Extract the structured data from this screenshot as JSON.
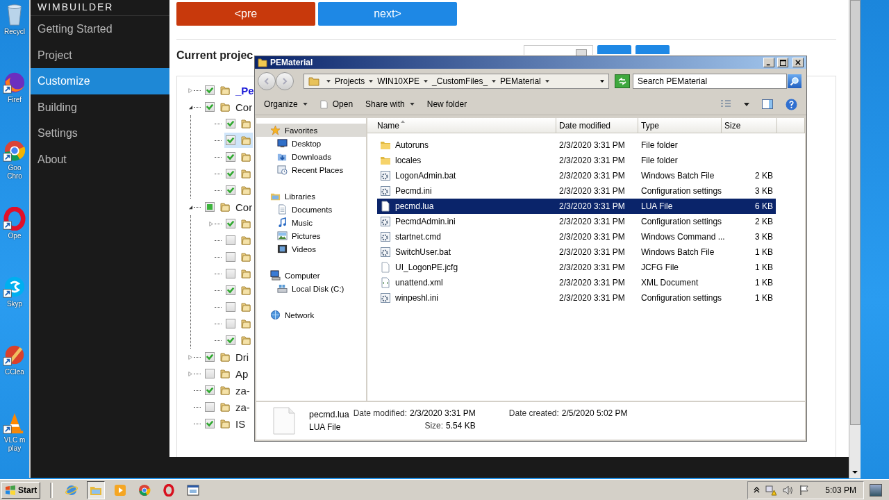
{
  "desktop": {
    "icons": [
      {
        "label": "Recycl",
        "kind": "bin"
      },
      {
        "label": "Firef",
        "kind": "firefox"
      },
      {
        "label": "Goo Chro",
        "kind": "chrome"
      },
      {
        "label": "Ope",
        "kind": "opera"
      },
      {
        "label": "Skyp",
        "kind": "skype"
      },
      {
        "label": "CClea",
        "kind": "ccleaner"
      },
      {
        "label": "VLC m play",
        "kind": "vlc"
      }
    ]
  },
  "app": {
    "title": "WIMBUILDER",
    "menu": [
      {
        "label": "Getting Started",
        "selected": false
      },
      {
        "label": "Project",
        "selected": false
      },
      {
        "label": "Customize",
        "selected": true
      },
      {
        "label": "Building",
        "selected": false
      },
      {
        "label": "Settings",
        "selected": false
      },
      {
        "label": "About",
        "selected": false
      }
    ],
    "buttons": [
      {
        "label": "<pre",
        "kind": "prev"
      },
      {
        "label": "next>",
        "kind": "next"
      }
    ],
    "project_label": "Current projec",
    "tree": [
      {
        "label": "_Pe",
        "link": true,
        "checked": true,
        "expanded": false,
        "selected": false
      },
      {
        "label": "Cor",
        "link": false,
        "checked": true,
        "expanded": true,
        "selected": false,
        "children": [
          {
            "checked": true,
            "selected": false
          },
          {
            "checked": true,
            "selected": true
          },
          {
            "checked": true,
            "selected": false
          },
          {
            "checked": true,
            "selected": false
          },
          {
            "checked": true,
            "selected": false
          }
        ]
      },
      {
        "label": "Cor",
        "link": false,
        "checked": false,
        "mixed": true,
        "expanded": true,
        "selected": false,
        "children": [
          {
            "checked": true,
            "expanded": false,
            "selected": false
          },
          {
            "checked": false,
            "selected": false
          },
          {
            "checked": false,
            "selected": false
          },
          {
            "checked": false,
            "selected": false
          },
          {
            "checked": true,
            "selected": false
          },
          {
            "checked": false,
            "selected": false
          },
          {
            "checked": false,
            "selected": false
          },
          {
            "checked": true,
            "selected": false
          }
        ]
      },
      {
        "label": "Dri",
        "link": false,
        "checked": true,
        "expanded": false,
        "selected": false
      },
      {
        "label": "Ap",
        "link": false,
        "checked": false,
        "expanded": false,
        "selected": false
      },
      {
        "label": "za-",
        "link": false,
        "checked": true,
        "selected": false
      },
      {
        "label": "za-",
        "link": false,
        "checked": false,
        "selected": false
      },
      {
        "label": "IS",
        "link": false,
        "checked": true,
        "selected": false
      }
    ]
  },
  "explorer": {
    "title": "PEMaterial",
    "breadcrumb": [
      "Projects",
      "WIN10XPE",
      "_CustomFiles_",
      "PEMaterial"
    ],
    "search": {
      "placeholder": "Search PEMaterial"
    },
    "toolbar": [
      {
        "label": "Organize",
        "kind": "menu"
      },
      {
        "label": "Open",
        "kind": "open"
      },
      {
        "label": "Share with",
        "kind": "menu"
      },
      {
        "label": "New folder",
        "kind": "plain"
      }
    ],
    "nav": [
      {
        "label": "Favorites",
        "kind": "star",
        "selected": true,
        "children": [
          {
            "label": "Desktop",
            "kind": "desktop",
            "selected": false
          },
          {
            "label": "Downloads",
            "kind": "downloads",
            "selected": false
          },
          {
            "label": "Recent Places",
            "kind": "recent",
            "selected": false
          }
        ]
      },
      {
        "label": "Libraries",
        "kind": "libraries",
        "selected": false,
        "children": [
          {
            "label": "Documents",
            "kind": "documents",
            "selected": false
          },
          {
            "label": "Music",
            "kind": "music",
            "selected": false
          },
          {
            "label": "Pictures",
            "kind": "pictures",
            "selected": false
          },
          {
            "label": "Videos",
            "kind": "videos",
            "selected": false
          }
        ]
      },
      {
        "label": "Computer",
        "kind": "computer",
        "selected": false,
        "children": [
          {
            "label": "Local Disk (C:)",
            "kind": "disk",
            "selected": false
          }
        ]
      },
      {
        "label": "Network",
        "kind": "network",
        "selected": false
      }
    ],
    "columns": [
      {
        "label": "Name",
        "sorted": true
      },
      {
        "label": "Date modified",
        "sorted": false
      },
      {
        "label": "Type",
        "sorted": false
      },
      {
        "label": "Size",
        "sorted": false
      }
    ],
    "files": [
      {
        "name": "Autoruns",
        "date": "2/3/2020 3:31 PM",
        "type": "File folder",
        "kind": "folder",
        "selected": false
      },
      {
        "name": "locales",
        "date": "2/3/2020 3:31 PM",
        "type": "File folder",
        "kind": "folder",
        "selected": false
      },
      {
        "name": "LogonAdmin.bat",
        "date": "2/3/2020 3:31 PM",
        "type": "Windows Batch File",
        "size": "2 KB",
        "kind": "batch",
        "selected": false
      },
      {
        "name": "Pecmd.ini",
        "date": "2/3/2020 3:31 PM",
        "type": "Configuration settings",
        "size": "3 KB",
        "kind": "settings",
        "selected": false
      },
      {
        "name": "pecmd.lua",
        "date": "2/3/2020 3:31 PM",
        "type": "LUA File",
        "size": "6 KB",
        "kind": "plain",
        "selected": true
      },
      {
        "name": "PecmdAdmin.ini",
        "date": "2/3/2020 3:31 PM",
        "type": "Configuration settings",
        "size": "2 KB",
        "kind": "settings",
        "selected": false
      },
      {
        "name": "startnet.cmd",
        "date": "2/3/2020 3:31 PM",
        "type": "Windows Command ...",
        "size": "3 KB",
        "kind": "batch",
        "selected": false
      },
      {
        "name": "SwitchUser.bat",
        "date": "2/3/2020 3:31 PM",
        "type": "Windows Batch File",
        "size": "1 KB",
        "kind": "batch",
        "selected": false
      },
      {
        "name": "UI_LogonPE.jcfg",
        "date": "2/3/2020 3:31 PM",
        "type": "JCFG File",
        "size": "1 KB",
        "kind": "plain",
        "selected": false
      },
      {
        "name": "unattend.xml",
        "date": "2/3/2020 3:31 PM",
        "type": "XML Document",
        "size": "1 KB",
        "kind": "xml",
        "selected": false
      },
      {
        "name": "winpeshl.ini",
        "date": "2/3/2020 3:31 PM",
        "type": "Configuration settings",
        "size": "1 KB",
        "kind": "settings",
        "selected": false
      }
    ],
    "details": {
      "name": "pecmd.lua",
      "type": "LUA File",
      "fields": [
        {
          "label": "Date modified:",
          "value": "2/3/2020 3:31 PM"
        },
        {
          "label": "Date created:",
          "value": "2/5/2020 5:02 PM"
        },
        {
          "label": "Size:",
          "value": "5.54 KB"
        }
      ]
    }
  },
  "taskbar": {
    "start": "Start",
    "apps": [
      {
        "kind": "ie",
        "selected": false
      },
      {
        "kind": "folder",
        "selected": true
      },
      {
        "kind": "media",
        "selected": false
      },
      {
        "kind": "chrome",
        "selected": false
      },
      {
        "kind": "opera",
        "selected": false
      },
      {
        "kind": "window",
        "selected": false
      }
    ],
    "clock": "5:03 PM"
  }
}
